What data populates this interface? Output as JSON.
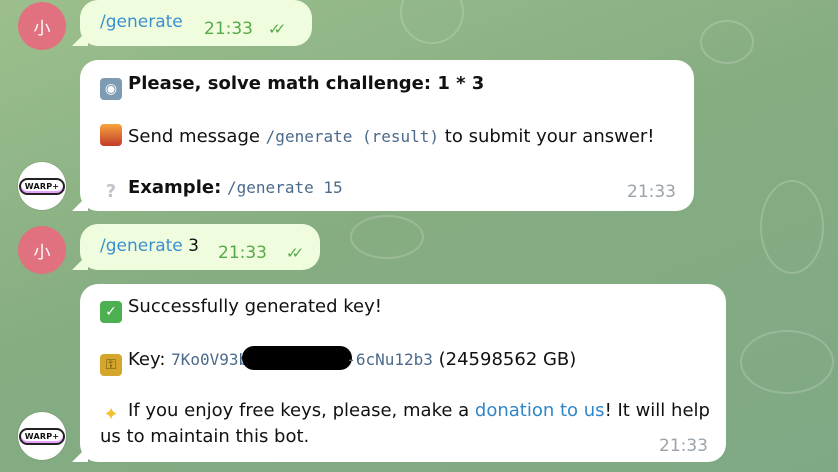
{
  "messages": [
    {
      "command": "/generate",
      "argument": "",
      "time": "21:33"
    },
    {
      "command": "/generate",
      "argument": "3",
      "time": "21:33"
    }
  ],
  "user_avatar": {
    "glyph": "小"
  },
  "bot_avatar": {
    "badge": "WARP+"
  },
  "bot_reply1": {
    "challenge": "Please, solve math challenge: 1 * 3",
    "send_pre": "Send message ",
    "send_cmd": "/generate (result)",
    "send_post": " to submit your answer!",
    "example_label": "Example:",
    "example_cmd": "/generate 15",
    "time": "21:33"
  },
  "bot_reply2": {
    "success": "Successfully generated key!",
    "key_label": "Key:",
    "key_start": "7Ko0V93b",
    "key_end": "-6cNu12b3",
    "key_size": "(24598562 GB)",
    "donate_pre": "If you enjoy free keys, please, make a ",
    "donate_link": "donation to us",
    "donate_post": "! It will help",
    "donate_line2": "us to maintain this bot.",
    "time": "21:33"
  },
  "icons": {
    "robot": "robot-icon",
    "city": "city-sunset-icon",
    "question": "question-mark-icon",
    "check": "check-mark-button-icon",
    "lock": "lock-with-key-icon",
    "sparkles": "sparkles-icon"
  },
  "colors": {
    "outgoing_bubble": "#effdde",
    "incoming_bubble": "#ffffff",
    "accent_green": "#58a948",
    "command_blue": "#3a8fd0",
    "user_avatar": "#e2717f"
  }
}
